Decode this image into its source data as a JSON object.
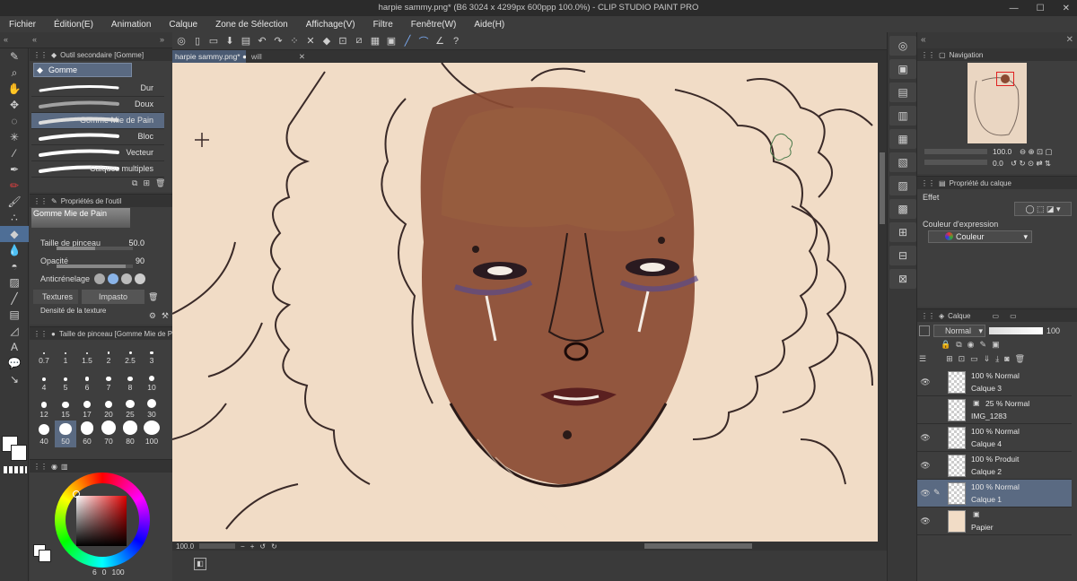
{
  "window": {
    "title": "harpie sammy.png* (B6 3024 x 4299px 600ppp 100.0%) - CLIP STUDIO PAINT PRO"
  },
  "menu": [
    "Fichier",
    "Édition(E)",
    "Animation",
    "Calque",
    "Zone de Sélection",
    "Affichage(V)",
    "Filtre",
    "Fenêtre(W)",
    "Aide(H)"
  ],
  "subtool_panel": {
    "title": "Outil secondaire [Gomme]",
    "group": "Gomme",
    "items": [
      {
        "label": "Dur",
        "selected": false
      },
      {
        "label": "Doux",
        "selected": false
      },
      {
        "label": "Gomme Mie de Pain",
        "selected": true
      },
      {
        "label": "Bloc",
        "selected": false
      },
      {
        "label": "Vecteur",
        "selected": false
      },
      {
        "label": "Calques multiples",
        "selected": false
      }
    ]
  },
  "tool_props": {
    "title": "Propriétés de l'outil",
    "tool_name": "Gomme Mie de Pain",
    "brush_size_label": "Taille de pinceau",
    "brush_size_value": "50.0",
    "opacity_label": "Opacité",
    "opacity_value": "90",
    "antialias_label": "Anticrénelage",
    "textures_label": "Textures",
    "impasto_label": "Impasto",
    "texture_density_label": "Densité de la texture"
  },
  "brush_size_panel": {
    "title": "Taille de pinceau [Gomme Mie de Pa",
    "sizes": [
      "0.7",
      "1",
      "1.5",
      "2",
      "2.5",
      "3",
      "4",
      "5",
      "6",
      "7",
      "8",
      "10",
      "12",
      "15",
      "17",
      "20",
      "25",
      "30",
      "40",
      "50",
      "60",
      "70",
      "80",
      "100"
    ],
    "selected": "50"
  },
  "color_panel": {
    "values": [
      "6",
      "0",
      "100"
    ]
  },
  "tabs": [
    {
      "label": "harpie sammy.png*",
      "active": true
    },
    {
      "label": "will",
      "active": false
    }
  ],
  "status": {
    "zoom": "100.0"
  },
  "navigator": {
    "title": "Navigation",
    "zoom": "100.0",
    "angle": "0.0"
  },
  "layer_props": {
    "title": "Propriété du calque",
    "effect_label": "Effet",
    "expr_color_label": "Couleur d'expression",
    "expr_color_value": "Couleur"
  },
  "layers_panel": {
    "title": "Calque",
    "blend_mode": "Normal",
    "opacity": "100",
    "layers": [
      {
        "mode": "100 % Normal",
        "name": "Calque 3",
        "visible": true,
        "selected": false
      },
      {
        "mode": "25 % Normal",
        "name": "IMG_1283",
        "visible": false,
        "selected": false
      },
      {
        "mode": "100 % Normal",
        "name": "Calque 4",
        "visible": true,
        "selected": false
      },
      {
        "mode": "100 % Produit",
        "name": "Calque 2",
        "visible": true,
        "selected": false
      },
      {
        "mode": "100 % Normal",
        "name": "Calque 1",
        "visible": true,
        "selected": true
      },
      {
        "mode": "",
        "name": "Papier",
        "visible": true,
        "selected": false
      }
    ]
  },
  "colors": {
    "accent": "#5a6a82",
    "paper": "#f1dcc6",
    "skin": "#8a4a32",
    "line": "#3a2a28"
  }
}
